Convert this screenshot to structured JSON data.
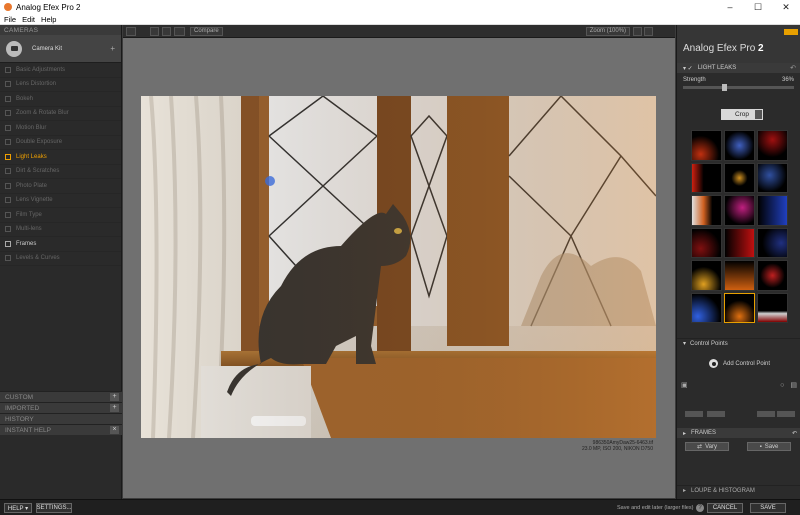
{
  "window": {
    "title": "Analog Efex Pro 2",
    "minimize": "–",
    "maximize": "☐",
    "close": "✕"
  },
  "menu": [
    "File",
    "Edit",
    "Help"
  ],
  "left": {
    "header": "CAMERAS",
    "camera_kit": "Camera Kit",
    "filters": [
      "Basic Adjustments",
      "Lens Distortion",
      "Bokeh",
      "Zoom & Rotate Blur",
      "Motion Blur",
      "Double Exposure",
      "Light Leaks",
      "Dirt & Scratches",
      "Photo Plate",
      "Lens Vignette",
      "Film Type",
      "Multi-lens",
      "Frames",
      "Levels & Curves"
    ],
    "active_filter": "Light Leaks",
    "sections": [
      "CUSTOM",
      "IMPORTED",
      "HISTORY",
      "INSTANT HELP"
    ]
  },
  "toolbar": {
    "compare": "Compare",
    "zoom": "Zoom (100%)"
  },
  "image_meta": {
    "filename": "986350AmyDaw25-6463.tif",
    "info": "23.0 MP, ISO 200, NIKON D750"
  },
  "right": {
    "brand": "Analog Efex Pro",
    "brand_num": "2",
    "section": "LIGHT LEAKS",
    "strength_label": "Strength",
    "strength_value": "36%",
    "strength_fraction": 0.36,
    "crop_label": "Crop",
    "control_points": "Control Points",
    "add_control_point": "Add Control Point",
    "frames": "FRAMES",
    "vary": "Vary",
    "save": "Save",
    "loupe": "LOUPE & HISTOGRAM"
  },
  "bottom": {
    "help": "HELP ▾",
    "settings": "SETTINGS...",
    "save_text": "Save and edit later (larger files)",
    "cancel": "CANCEL",
    "save": "SAVE"
  }
}
